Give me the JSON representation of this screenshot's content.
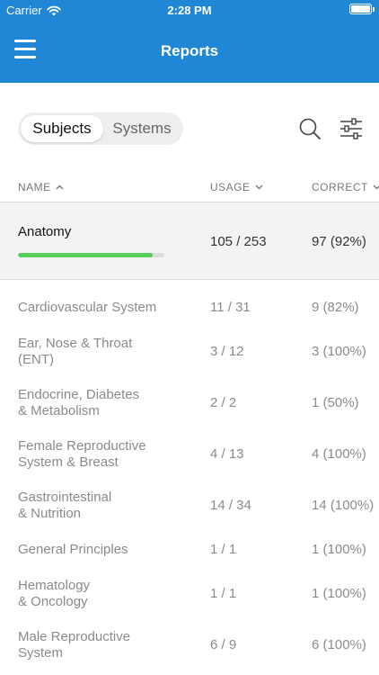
{
  "status_bar": {
    "carrier": "Carrier",
    "time": "2:28 PM",
    "signal_icon": "wifi-icon",
    "battery_icon": "battery-icon"
  },
  "nav": {
    "title": "Reports",
    "menu_icon": "hamburger-menu-icon"
  },
  "segmented": {
    "options": [
      "Subjects",
      "Systems"
    ],
    "selected": "Subjects"
  },
  "toolbar": {
    "search_icon": "search-icon",
    "filter_icon": "filter-sliders-icon"
  },
  "columns": {
    "name": "NAME",
    "usage": "USAGE",
    "correct": "CORRECT"
  },
  "highlight": {
    "name": "Anatomy",
    "usage": "105 / 253",
    "correct": "97 (92%)",
    "progress": 0.92,
    "progress_color": "#57cf5a"
  },
  "rows": [
    {
      "name": [
        "Cardiovascular System"
      ],
      "usage": "11 / 31",
      "correct": "9 (82%)"
    },
    {
      "name": [
        "Ear, Nose & Throat",
        "(ENT)"
      ],
      "usage": "3 / 12",
      "correct": "3 (100%)"
    },
    {
      "name": [
        "Endocrine, Diabetes",
        "& Metabolism"
      ],
      "usage": "2 / 2",
      "correct": "1 (50%)"
    },
    {
      "name": [
        "Female Reproductive",
        "System & Breast"
      ],
      "usage": "4 / 13",
      "correct": "4 (100%)"
    },
    {
      "name": [
        "Gastrointestinal",
        "& Nutrition"
      ],
      "usage": "14 / 34",
      "correct": "14 (100%)"
    },
    {
      "name": [
        "General Principles"
      ],
      "usage": "1 / 1",
      "correct": "1 (100%)"
    },
    {
      "name": [
        "Hematology",
        "& Oncology"
      ],
      "usage": "1 / 1",
      "correct": "1 (100%)"
    },
    {
      "name": [
        "Male Reproductive",
        "System"
      ],
      "usage": "6 / 9",
      "correct": "6 (100%)"
    }
  ],
  "colors": {
    "nav_bar": "#1f87d6",
    "accent_green": "#57cf5a",
    "highlight_bg": "#f3f3f3"
  }
}
